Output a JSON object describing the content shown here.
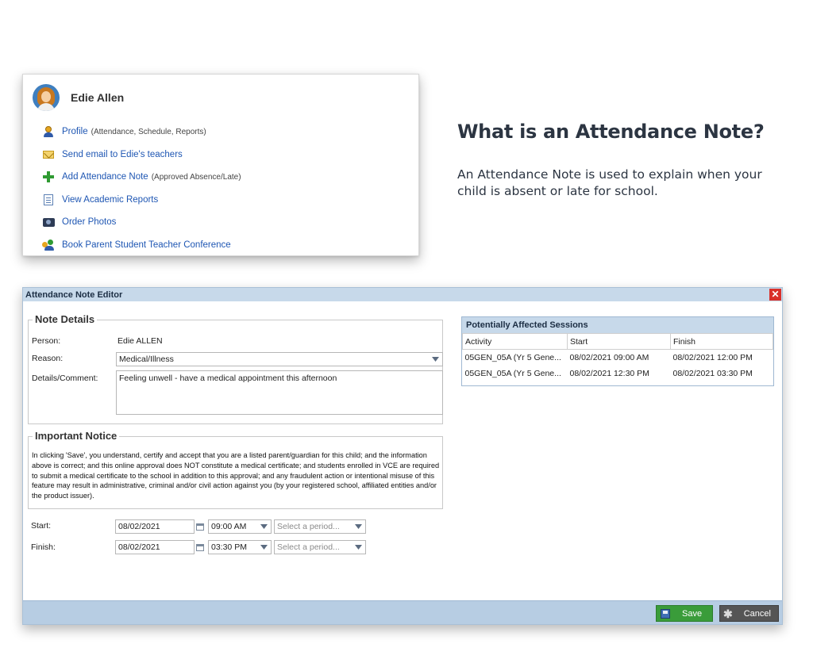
{
  "menu": {
    "name": "Edie Allen",
    "items": [
      {
        "icon": "person-icon",
        "label": "Profile",
        "extra": "(Attendance, Schedule, Reports)"
      },
      {
        "icon": "envelope-icon",
        "label": "Send email to Edie's teachers",
        "extra": ""
      },
      {
        "icon": "plus-icon",
        "label": "Add Attendance Note",
        "extra": "(Approved Absence/Late)"
      },
      {
        "icon": "report-icon",
        "label": "View Academic Reports",
        "extra": ""
      },
      {
        "icon": "photo-icon",
        "label": "Order Photos",
        "extra": ""
      },
      {
        "icon": "group-icon",
        "label": "Book Parent Student Teacher Conference",
        "extra": ""
      }
    ]
  },
  "info": {
    "title": "What is an Attendance Note?",
    "description": "An Attendance Note is used to explain when your child is absent or late for school."
  },
  "editor": {
    "title": "Attendance Note Editor",
    "note_details": {
      "legend": "Note Details",
      "person_label": "Person:",
      "person_value": "Edie ALLEN",
      "reason_label": "Reason:",
      "reason_value": "Medical/Illness",
      "details_label": "Details/Comment:",
      "details_value": "Feeling unwell - have a medical appointment this afternoon"
    },
    "notice": {
      "legend": "Important Notice",
      "text": "In clicking 'Save', you understand, certify and accept that you are a listed parent/guardian for this child; and the information above is correct; and this online approval does NOT constitute a medical certificate; and students enrolled in VCE are required to submit a medical certificate to the school in addition to this approval; and any fraudulent action or intentional misuse of this feature may result in administrative, criminal and/or civil action against you (by your registered school, affiliated entities and/or the product issuer)."
    },
    "start": {
      "label": "Start:",
      "date": "08/02/2021",
      "time": "09:00 AM",
      "period_placeholder": "Select a period..."
    },
    "finish": {
      "label": "Finish:",
      "date": "08/02/2021",
      "time": "03:30 PM",
      "period_placeholder": "Select a period..."
    },
    "sessions": {
      "title": "Potentially Affected Sessions",
      "columns": [
        "Activity",
        "Start",
        "Finish"
      ],
      "rows": [
        [
          "05GEN_05A (Yr 5 Gene...",
          "08/02/2021 09:00 AM",
          "08/02/2021 12:00 PM"
        ],
        [
          "05GEN_05A (Yr 5 Gene...",
          "08/02/2021 12:30 PM",
          "08/02/2021 03:30 PM"
        ]
      ]
    },
    "save_label": "Save",
    "cancel_label": "Cancel",
    "close_glyph": "✕"
  }
}
